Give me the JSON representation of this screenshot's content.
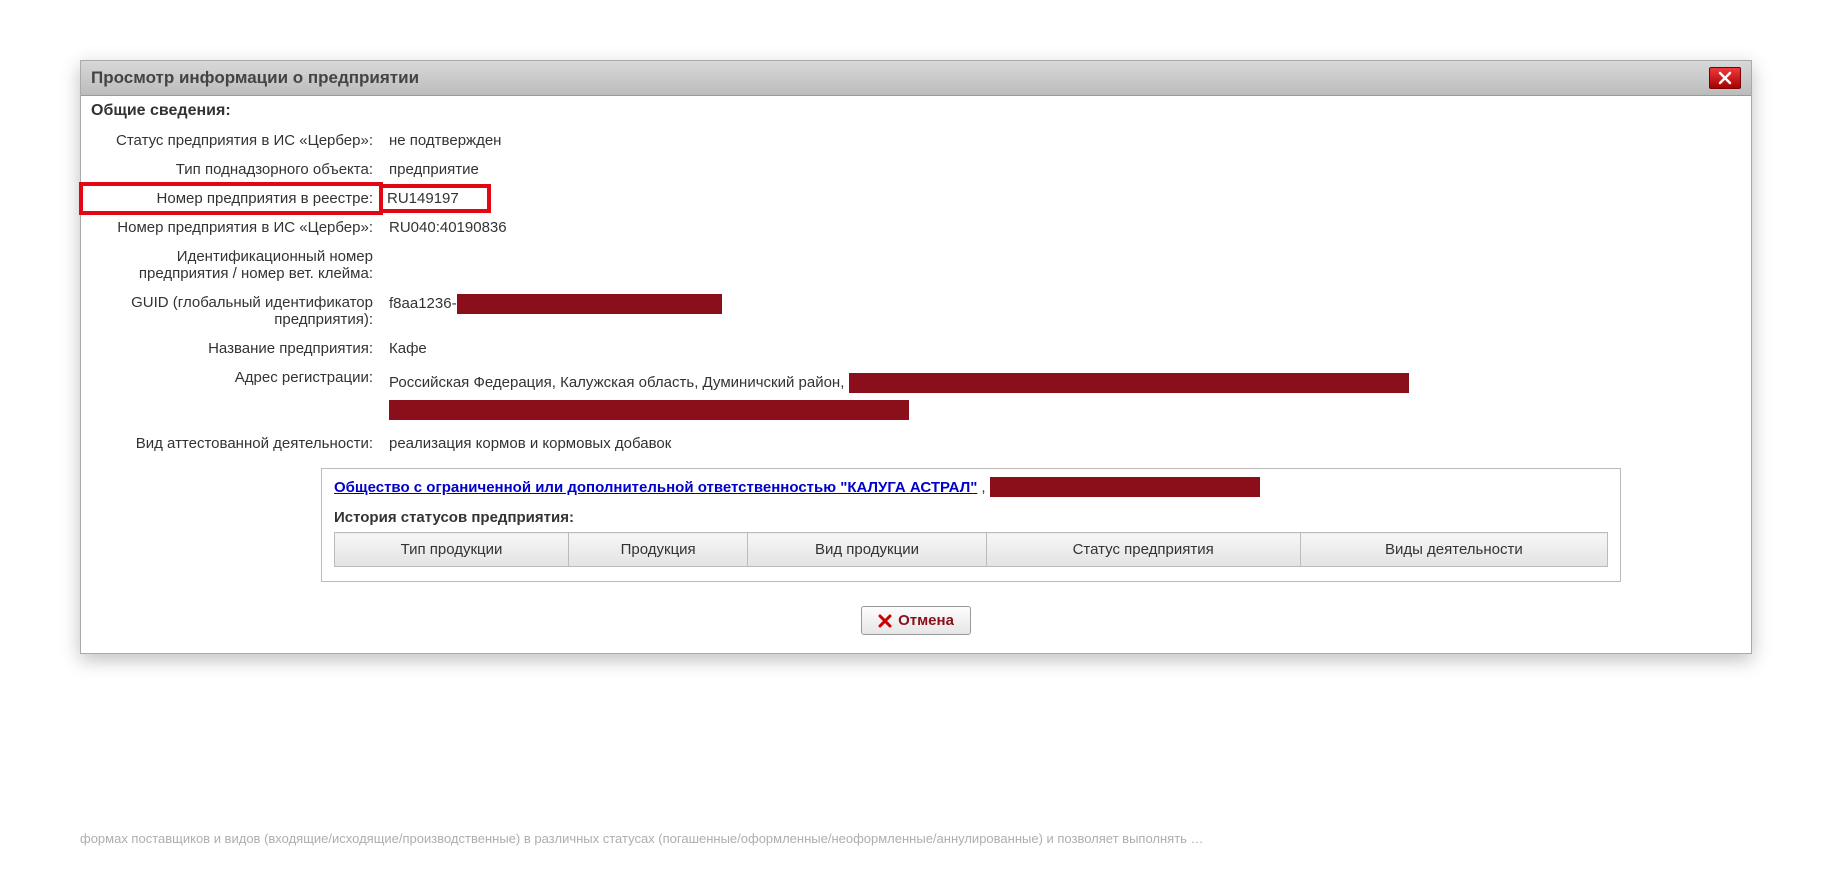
{
  "dialog": {
    "title": "Просмотр информации о предприятии"
  },
  "section": {
    "general": "Общие сведения:"
  },
  "fields": {
    "status": {
      "label": "Статус предприятия в ИС «Цербер»:",
      "value": "не подтвержден"
    },
    "objtype": {
      "label": "Тип поднадзорного объекта:",
      "value": "предприятие"
    },
    "regnum": {
      "label": "Номер предприятия в реестре:",
      "value": "RU149197"
    },
    "cerbnum": {
      "label": "Номер предприятия в ИС «Цербер»:",
      "value": "RU040:40190836"
    },
    "idnum": {
      "label": "Идентификационный номер предприятия / номер вет. клейма:",
      "value": ""
    },
    "guid": {
      "label": "GUID (глобальный идентификатор предприятия):",
      "value_prefix": "f8aa1236-"
    },
    "name": {
      "label": "Название предприятия:",
      "value": "Кафе"
    },
    "addr": {
      "label": "Адрес регистрации:",
      "value_prefix": "Российская Федерация, Калужская область, Думиничский район,"
    },
    "activity": {
      "label": "Вид аттестованной деятельности:",
      "value": "реализация кормов и кормовых добавок"
    }
  },
  "org": {
    "link_text": "Общество с ограниченной или дополнительной ответственностью \"КАЛУГА АСТРАЛ\"",
    "suffix": ","
  },
  "history": {
    "title": "История статусов предприятия:",
    "columns": [
      "Тип продукции",
      "Продукция",
      "Вид продукции",
      "Статус предприятия",
      "Виды деятельности"
    ]
  },
  "buttons": {
    "cancel": "Отмена"
  },
  "background_hint": "формах поставщиков и видов (входящие/исходящие/производственные) в различных статусах (погашенные/оформленные/неоформленные/аннулированные) и позволяет выполнять …"
}
